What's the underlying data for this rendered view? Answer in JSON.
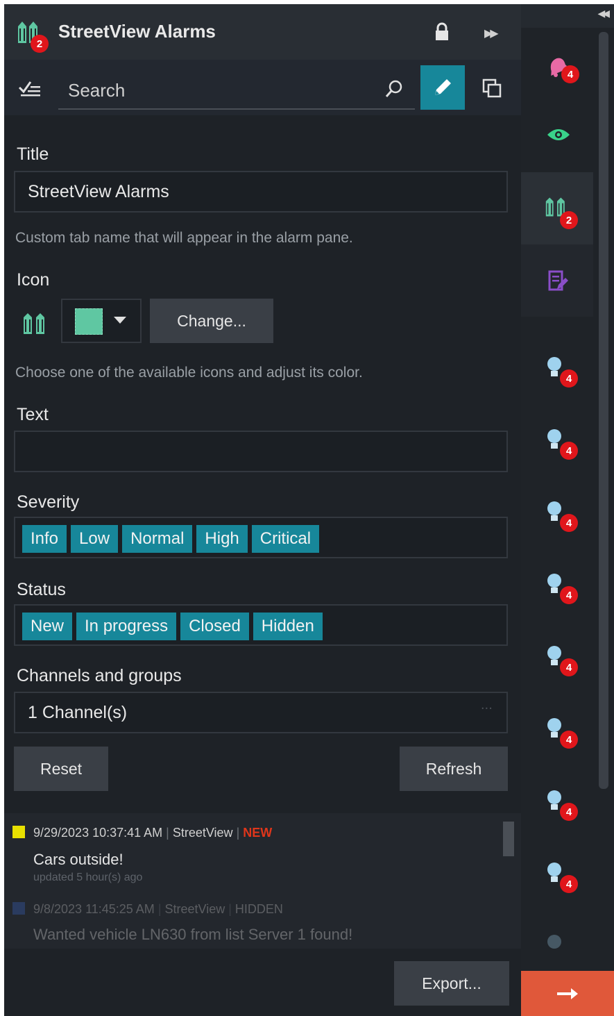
{
  "header": {
    "title": "StreetView Alarms",
    "badge_count": "2"
  },
  "toolbar": {
    "search_placeholder": "Search"
  },
  "form": {
    "title_label": "Title",
    "title_value": "StreetView Alarms",
    "title_hint": "Custom tab name that will appear in the alarm pane.",
    "icon_label": "Icon",
    "icon_color": "#5fc7a2",
    "change_button": "Change...",
    "icon_hint": "Choose one of the available icons and adjust its color.",
    "text_label": "Text",
    "text_value": "",
    "severity_label": "Severity",
    "severity_chips": [
      "Info",
      "Low",
      "Normal",
      "High",
      "Critical"
    ],
    "status_label": "Status",
    "status_chips": [
      "New",
      "In progress",
      "Closed",
      "Hidden"
    ],
    "channels_label": "Channels and groups",
    "channels_value": "1 Channel(s)",
    "reset_button": "Reset",
    "refresh_button": "Refresh"
  },
  "alarms": [
    {
      "square_color": "#e8e000",
      "datetime": "9/29/2023 10:37:41 AM",
      "source": "StreetView",
      "status": "NEW",
      "message": "Cars outside!",
      "updated": "updated 5 hour(s) ago"
    },
    {
      "square_color": "#3a66c8",
      "datetime": "9/8/2023 11:45:25 AM",
      "source": "StreetView",
      "status": "HIDDEN",
      "message": "Wanted vehicle LN630 from list Server 1 found!"
    }
  ],
  "footer": {
    "export_button": "Export..."
  },
  "rail": {
    "bell_badge": "4",
    "buildings_badge": "2",
    "bulb_badges": [
      "4",
      "4",
      "4",
      "4",
      "4",
      "4",
      "4",
      "4"
    ]
  },
  "colors": {
    "accent": "#17879a",
    "badge": "#e0161b",
    "eye": "#39d38a",
    "bell": "#e86aa5",
    "note": "#8a4ec8",
    "bulb": "#9fd2ee",
    "arrow_bg": "#e0583a"
  }
}
